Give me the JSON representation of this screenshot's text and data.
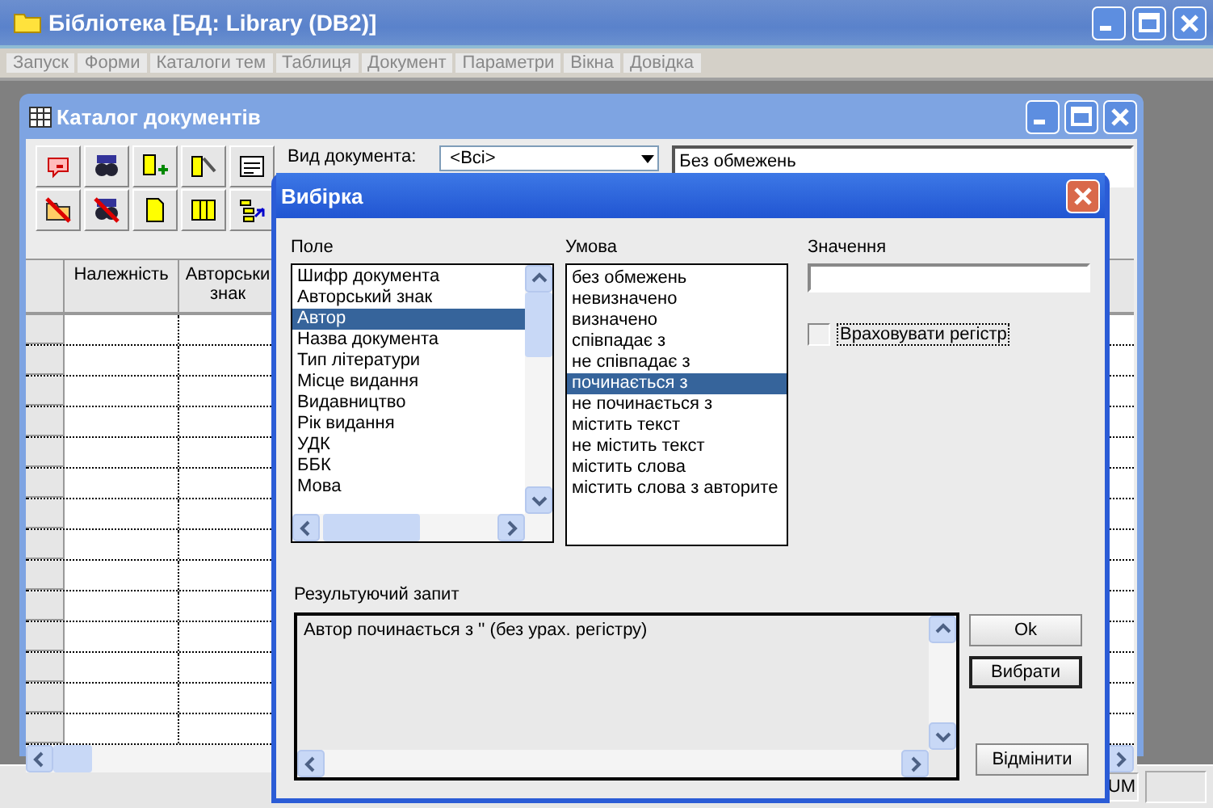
{
  "window": {
    "title": "Бібліотека [БД: Library (DB2)]"
  },
  "menu": [
    "Запуск",
    "Форми",
    "Каталоги тем",
    "Таблиця",
    "Документ",
    "Параметри",
    "Вікна",
    "Довідка"
  ],
  "catalog_window": {
    "title": "Каталог документів",
    "document_type_label": "Вид документа:",
    "document_type": "<Всі>",
    "filter_summary": "Без обмежень",
    "table": {
      "columns": [
        "Належність",
        "Авторськи знак"
      ]
    }
  },
  "dialog": {
    "title": "Вибірка",
    "field_label": "Поле",
    "fields": [
      {
        "label": "Шифр документа",
        "selected": false
      },
      {
        "label": "Авторський знак",
        "selected": false
      },
      {
        "label": "Автор",
        "selected": true
      },
      {
        "label": "Назва документа",
        "selected": false
      },
      {
        "label": "Тип літератури",
        "selected": false
      },
      {
        "label": "Місце видання",
        "selected": false
      },
      {
        "label": "Видавництво",
        "selected": false
      },
      {
        "label": "Рік видання",
        "selected": false
      },
      {
        "label": "УДК",
        "selected": false
      },
      {
        "label": "ББК",
        "selected": false
      },
      {
        "label": "Мова",
        "selected": false
      }
    ],
    "condition_label": "Умова",
    "conditions": [
      {
        "label": "без обмежень",
        "selected": false
      },
      {
        "label": "невизначено",
        "selected": false
      },
      {
        "label": "визначено",
        "selected": false
      },
      {
        "label": "співпадає з",
        "selected": false
      },
      {
        "label": "не співпадає з",
        "selected": false
      },
      {
        "label": "починається з",
        "selected": true
      },
      {
        "label": "не починається з",
        "selected": false
      },
      {
        "label": "містить текст",
        "selected": false
      },
      {
        "label": "не містить текст",
        "selected": false
      },
      {
        "label": "містить слова",
        "selected": false
      },
      {
        "label": "містить слова з авторите",
        "selected": false
      }
    ],
    "value_label": "Значення",
    "case_sensitive": {
      "label": "Враховувати регістр",
      "checked": false
    },
    "result_label": "Результуючий запит",
    "result_query": "Автор починається з '' (без урах. регістру)",
    "buttons": [
      {
        "label": "Ok",
        "default": false
      },
      {
        "label": "Вибрати",
        "default": true
      },
      {
        "label": "Відмінити",
        "default": false
      }
    ]
  },
  "status_bar": {
    "indicator": "UM"
  }
}
